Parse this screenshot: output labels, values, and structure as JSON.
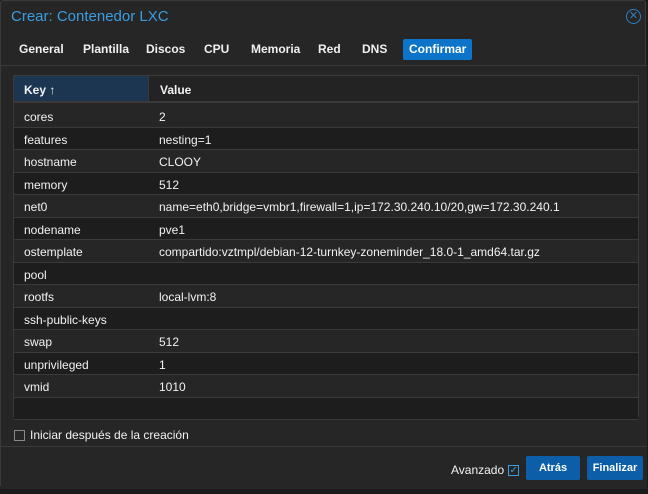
{
  "window": {
    "title": "Crear: Contenedor LXC",
    "close_icon": "close-circle-icon"
  },
  "tabs": [
    {
      "label": "General"
    },
    {
      "label": "Plantilla"
    },
    {
      "label": "Discos"
    },
    {
      "label": "CPU"
    },
    {
      "label": "Memoria"
    },
    {
      "label": "Red"
    },
    {
      "label": "DNS"
    },
    {
      "label": "Confirmar",
      "active": true
    }
  ],
  "grid": {
    "headers": {
      "key": "Key ↑",
      "value": "Value"
    },
    "rows": [
      {
        "key": "cores",
        "value": "2"
      },
      {
        "key": "features",
        "value": "nesting=1"
      },
      {
        "key": "hostname",
        "value": "CLOOY"
      },
      {
        "key": "memory",
        "value": "512"
      },
      {
        "key": "net0",
        "value": "name=eth0,bridge=vmbr1,firewall=1,ip=172.30.240.10/20,gw=172.30.240.1"
      },
      {
        "key": "nodename",
        "value": "pve1"
      },
      {
        "key": "ostemplate",
        "value": "compartido:vztmpl/debian-12-turnkey-zoneminder_18.0-1_amd64.tar.gz"
      },
      {
        "key": "pool",
        "value": ""
      },
      {
        "key": "rootfs",
        "value": "local-lvm:8"
      },
      {
        "key": "ssh-public-keys",
        "value": ""
      },
      {
        "key": "swap",
        "value": "512"
      },
      {
        "key": "unprivileged",
        "value": "1"
      },
      {
        "key": "vmid",
        "value": "1010"
      }
    ]
  },
  "start_after": {
    "label": "Iniciar después de la creación",
    "checked": false
  },
  "footer": {
    "advanced_label": "Avanzado",
    "advanced_checked": true,
    "back": "Atrás",
    "finish": "Finalizar"
  }
}
